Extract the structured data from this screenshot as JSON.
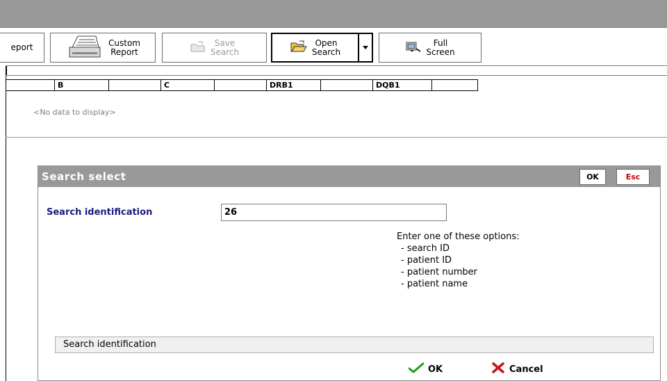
{
  "toolbar": {
    "report_label": "eport",
    "custom_report_label": "Custom\nReport",
    "save_search_label": "Save\nSearch",
    "open_search_label": "Open\nSearch",
    "full_screen_label": "Full\nScreen"
  },
  "results": {
    "columns": [
      "",
      "B",
      "",
      "C",
      "",
      "DRB1",
      "",
      "DQB1",
      ""
    ],
    "empty_message": "<No data to display>"
  },
  "dialog": {
    "title": "Search select",
    "ok_top": "OK",
    "esc_top": "Esc",
    "field_label": "Search identification",
    "field_value": "26",
    "hint_title": "Enter one of these options:",
    "hint_options": [
      "- search ID",
      "- patient ID",
      "- patient number",
      "- patient name"
    ],
    "status_text": "Search identification",
    "ok_label": "OK",
    "cancel_label": "Cancel"
  },
  "colors": {
    "title_bar": "#999999",
    "label_blue": "#1b1b7e",
    "esc_red": "#cc0000",
    "ok_green": "#1f9a1f",
    "cancel_red": "#cc1111"
  },
  "icons": [
    "printer-icon",
    "save-folder-icon",
    "open-folder-icon",
    "full-screen-icon",
    "checkmark-icon",
    "cross-icon",
    "dropdown-arrow-icon"
  ]
}
